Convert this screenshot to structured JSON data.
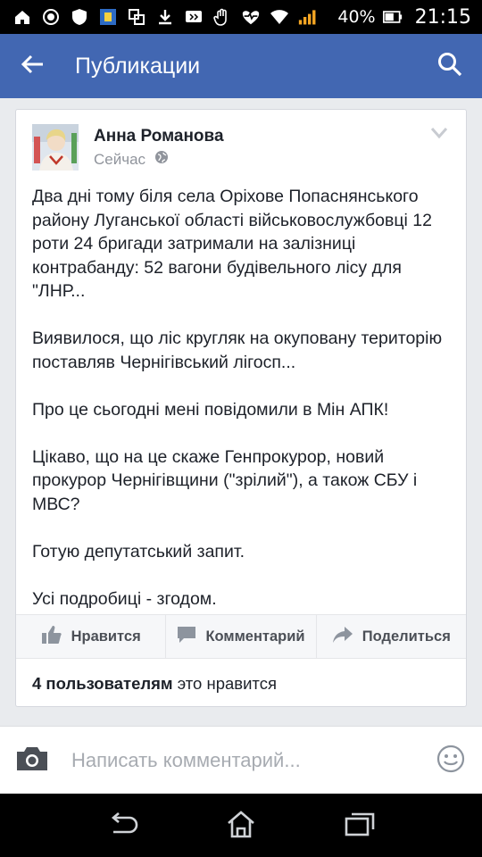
{
  "status_bar": {
    "battery": "40%",
    "time": "21:15"
  },
  "app_bar": {
    "title": "Публикации",
    "back_icon": "arrow-left-icon",
    "search_icon": "search-icon"
  },
  "post": {
    "author": "Анна Романова",
    "time": "Сейчас",
    "privacy_icon": "globe-icon",
    "paragraphs": [
      "Два дні тому біля села Оріхове Попаснянського району Луганської області військовослужбовці 12 роти 24 бригади затримали на залізниці контрабанду: 52 вагони будівельного лісу для \"ЛНР...",
      "Виявилося, що ліс кругляк на окуповану територію поставляв Чернігівський лігосп...",
      "Про це сьогодні мені повідомили в Мін АПК!",
      "Цікаво, що на це скаже Генпрокурор, новий прокурор Чернігівщини (\"зрілий\"), а також СБУ і МВС?",
      "Готую депутатський запит.",
      "Усі подробиці - згодом."
    ],
    "actions": {
      "like": "Нравится",
      "comment": "Комментарий",
      "share": "Поделиться"
    },
    "likes_bold": "4 пользователям",
    "likes_rest": " это нравится"
  },
  "comment_bar": {
    "placeholder": "Написать комментарий..."
  },
  "colors": {
    "brand": "#4267b2",
    "background": "#e9ebee",
    "icon_gray": "#90949c"
  }
}
